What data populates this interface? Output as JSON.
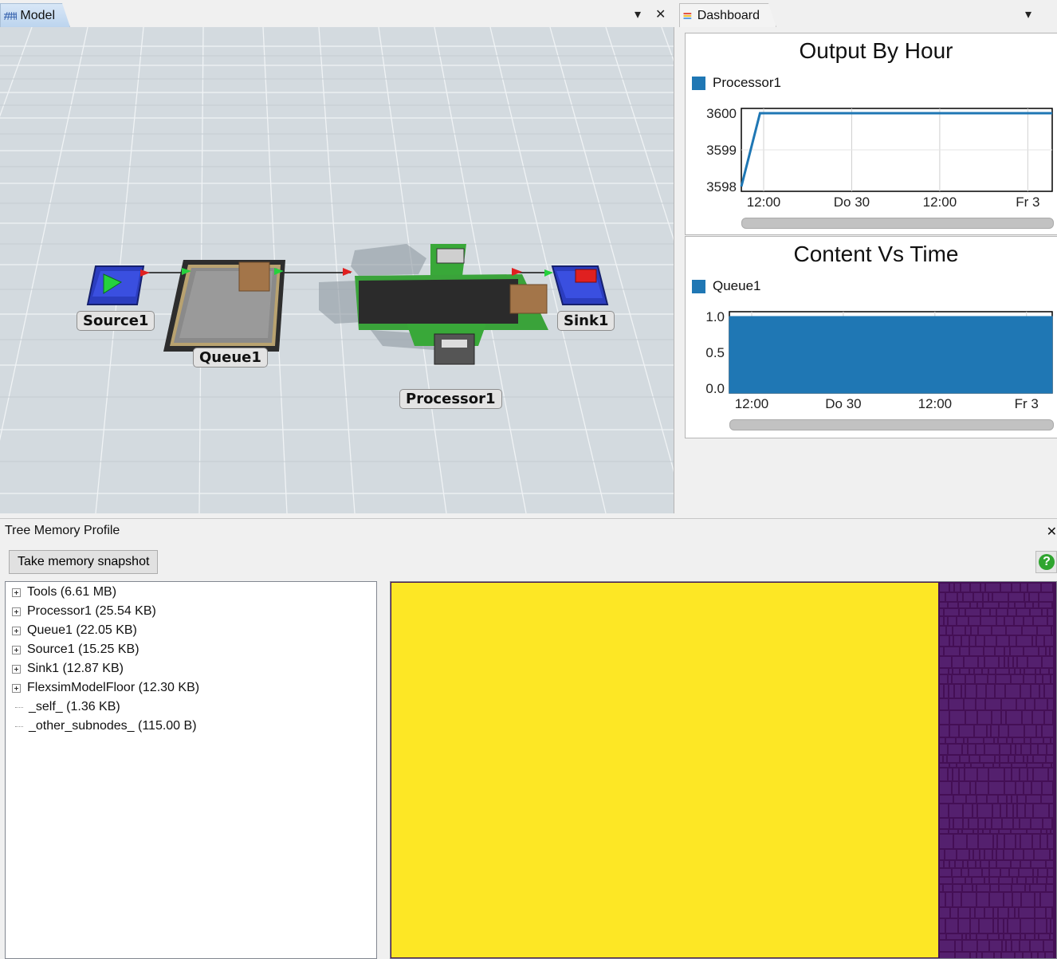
{
  "tabs": {
    "model": {
      "label": "Model"
    },
    "dashboard": {
      "label": "Dashboard"
    },
    "menu_glyph": "▾",
    "close_glyph": "✕"
  },
  "model": {
    "objects": {
      "source": "Source1",
      "queue": "Queue1",
      "processor": "Processor1",
      "sink": "Sink1"
    }
  },
  "dashboard": {
    "charts": [
      {
        "title": "Output By Hour",
        "legend": "Processor1",
        "y_ticks": [
          "3600",
          "3599",
          "3598"
        ],
        "x_ticks": [
          "12:00",
          "Do 30",
          "12:00",
          "Fr 3"
        ]
      },
      {
        "title": "Content Vs Time",
        "legend": "Queue1",
        "y_ticks": [
          "1.0",
          "0.5",
          "0.0"
        ],
        "x_ticks": [
          "12:00",
          "Do 30",
          "12:00",
          "Fr 3"
        ]
      }
    ]
  },
  "chart_data": [
    {
      "type": "line",
      "title": "Output By Hour",
      "series": [
        {
          "name": "Processor1",
          "x": [
            0,
            0.06,
            1
          ],
          "values": [
            3598,
            3600,
            3600
          ]
        }
      ],
      "ylim": [
        3598,
        3600
      ],
      "color": "#1f77b4"
    },
    {
      "type": "area",
      "title": "Content Vs Time",
      "series": [
        {
          "name": "Queue1",
          "x": [
            0,
            1
          ],
          "values": [
            1.0,
            1.0
          ]
        }
      ],
      "ylim": [
        0,
        1.0
      ],
      "color": "#1f77b4"
    }
  ],
  "memory": {
    "title": "Tree Memory Profile",
    "close_glyph": "✕",
    "snapshot_button": "Take memory snapshot",
    "help_glyph": "?",
    "tree": [
      {
        "label": "Tools (6.61 MB)",
        "expandable": true
      },
      {
        "label": "Processor1 (25.54 KB)",
        "expandable": true
      },
      {
        "label": "Queue1 (22.05 KB)",
        "expandable": true
      },
      {
        "label": "Source1 (15.25 KB)",
        "expandable": true
      },
      {
        "label": "Sink1 (12.87 KB)",
        "expandable": true
      },
      {
        "label": "FlexsimModelFloor (12.30 KB)",
        "expandable": true
      },
      {
        "label": "_self_ (1.36 KB)",
        "expandable": false
      },
      {
        "label": "_other_subnodes_ (115.00 B)",
        "expandable": false
      }
    ],
    "treemap_colors": {
      "major": "#fde725",
      "minor_bg": "#440f55",
      "minor_cell": "#54206e"
    }
  }
}
